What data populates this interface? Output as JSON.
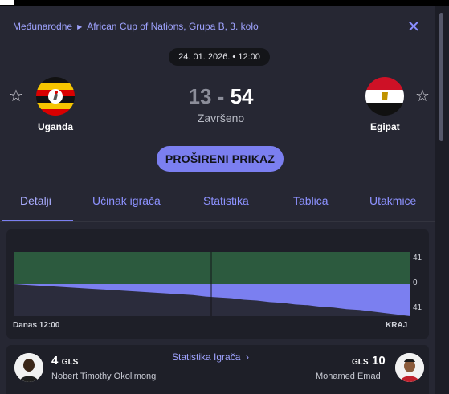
{
  "breadcrumb": {
    "category": "Međunarodne",
    "competition": "African Cup of Nations, Grupa B, 3. kolo"
  },
  "match": {
    "datetime": "24. 01. 2026. • 12:00",
    "home_team": "Uganda",
    "away_team": "Egipat",
    "home_score": "13",
    "separator": "-",
    "away_score": "54",
    "status": "Završeno"
  },
  "actions": {
    "expand_label": "PROŠIRENI PRIKAZ"
  },
  "tabs": [
    {
      "label": "Detalji",
      "active": true
    },
    {
      "label": "Učinak igrača",
      "active": false
    },
    {
      "label": "Statistika",
      "active": false
    },
    {
      "label": "Tablica",
      "active": false
    },
    {
      "label": "Utakmice",
      "active": false
    }
  ],
  "momentum": {
    "axis_top": "41",
    "axis_mid": "0",
    "axis_bottom": "41",
    "start_label": "Danas 12:00",
    "end_label": "KRAJ"
  },
  "chart_data": {
    "type": "area",
    "title": "",
    "xlabel": "",
    "ylabel": "",
    "x_start_label": "Danas 12:00",
    "x_end_label": "KRAJ",
    "ylim": [
      -41,
      41
    ],
    "ytick_labels": [
      "41",
      "0",
      "41"
    ],
    "midline": "halftime",
    "series": [
      {
        "values": [
          0,
          -1,
          -2,
          -3,
          -4,
          -5,
          -6,
          -7,
          -8,
          -9,
          -10,
          -11,
          -12,
          -13,
          -14,
          -16,
          -17,
          -18,
          -20,
          -21,
          -23,
          -24,
          -26,
          -27,
          -29,
          -30,
          -32,
          -33,
          -35,
          -37,
          -39,
          -41
        ]
      }
    ],
    "colors": {
      "home": "#2c5a3e",
      "away": "#7b7ff0"
    }
  },
  "top_players": {
    "link_label": "Statistika Igrača",
    "home": {
      "goals": "4",
      "unit": "GLS",
      "name": "Nobert Timothy Okolimong"
    },
    "away": {
      "goals": "10",
      "unit": "GLS",
      "name": "Mohamed Emad"
    }
  },
  "colors": {
    "accent": "#7b7ff0",
    "panel": "#262733",
    "background": "#1c1d26"
  }
}
